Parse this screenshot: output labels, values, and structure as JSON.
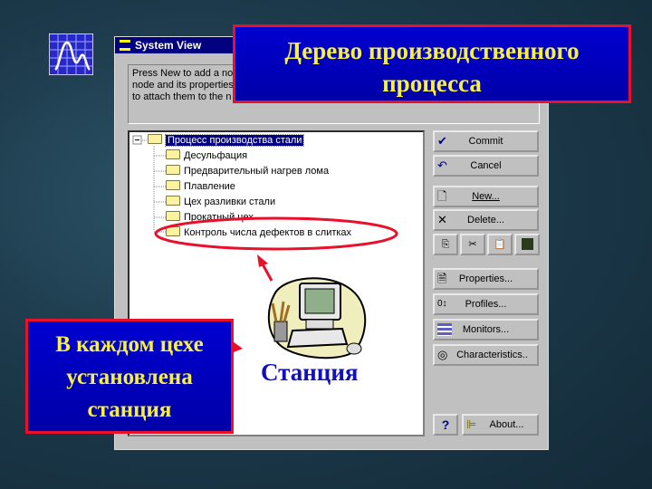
{
  "window": {
    "title": "System View",
    "info_lines": [
      "Press New to add a no",
      "node and its properties",
      "to attach them to the n                         to commit these ch"
    ]
  },
  "tree": {
    "root": "Процесс производства стали",
    "children": [
      "Десульфация",
      "Предварительный нагрев лома",
      "Плавление",
      "Цех разливки стали",
      "Прокатный цех",
      "Контроль числа дефектов в слитках"
    ]
  },
  "buttons": {
    "commit": "Commit",
    "cancel": "Cancel",
    "new": "New...",
    "delete": "Delete...",
    "properties": "Properties...",
    "profiles": "Profiles...",
    "monitors": "Monitors...",
    "characteristics": "Characteristics..",
    "help": "?",
    "about": "About..."
  },
  "callouts": {
    "top": "Дерево производственного процесса",
    "bottom": "В каждом цехе установлена станция"
  },
  "station_label": "Станция",
  "colors": {
    "callout_bg": "#0000c0",
    "callout_border": "#e8102a",
    "callout_text": "#f8f040",
    "highlight": "#e8102a",
    "title_bar": "#000080",
    "station_text": "#1010c0"
  }
}
